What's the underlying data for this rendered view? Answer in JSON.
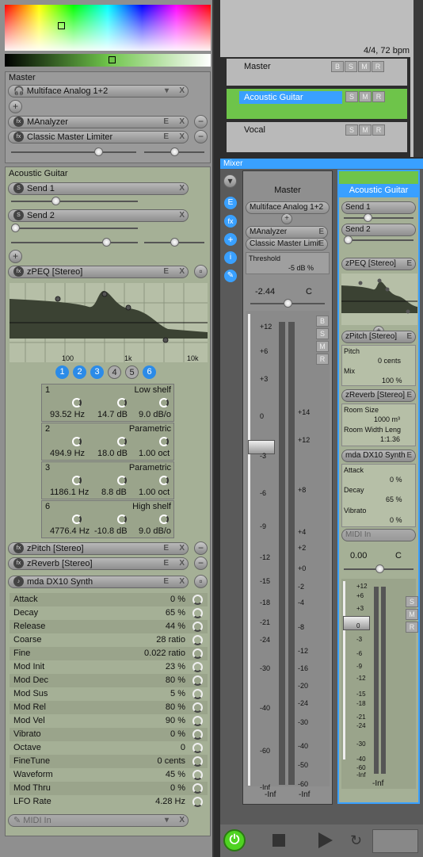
{
  "colors": {
    "panel": "#a5b096",
    "accent": "#39a0ff",
    "green": "#6ec44a"
  },
  "time_sig": "4/4, 72 bpm",
  "inspector": {
    "master_label": "Master",
    "device": "Multiface Analog 1+2",
    "master_fx": [
      "MAnalyzer",
      "Classic Master Limiter"
    ],
    "track_label": "Acoustic Guitar",
    "sends": [
      "Send 1",
      "Send 2"
    ],
    "zpeq": "zPEQ [Stereo]",
    "eq_freq_labels": [
      "100",
      "1k",
      "10k"
    ],
    "band_numbers": [
      "1",
      "2",
      "3",
      "4",
      "5",
      "6"
    ],
    "bands": [
      {
        "num": "1",
        "type": "Low shelf",
        "freq": "93.52 Hz",
        "gain": "14.7 dB",
        "q": "9.0 dB/o"
      },
      {
        "num": "2",
        "type": "Parametric",
        "freq": "494.9 Hz",
        "gain": "18.0 dB",
        "q": "1.00 oct"
      },
      {
        "num": "3",
        "type": "Parametric",
        "freq": "1186.1 Hz",
        "gain": "8.8 dB",
        "q": "1.00 oct"
      },
      {
        "num": "6",
        "type": "High shelf",
        "freq": "4776.4 Hz",
        "gain": "-10.8 dB",
        "q": "9.0 dB/o"
      }
    ],
    "zpitch": "zPitch [Stereo]",
    "zreverb": "zReverb [Stereo]",
    "synth": "mda DX10 Synth",
    "params": [
      {
        "n": "Attack",
        "v": "0 %"
      },
      {
        "n": "Decay",
        "v": "65 %"
      },
      {
        "n": "Release",
        "v": "44 %"
      },
      {
        "n": "Coarse",
        "v": "28 ratio"
      },
      {
        "n": "Fine",
        "v": "0.022 ratio"
      },
      {
        "n": "Mod Init",
        "v": "23 %"
      },
      {
        "n": "Mod Dec",
        "v": "80 %"
      },
      {
        "n": "Mod Sus",
        "v": "5 %"
      },
      {
        "n": "Mod Rel",
        "v": "80 %"
      },
      {
        "n": "Mod Vel",
        "v": "90 %"
      },
      {
        "n": "Vibrato",
        "v": "0 %"
      },
      {
        "n": "Octave",
        "v": "0"
      },
      {
        "n": "FineTune",
        "v": "0 cents"
      },
      {
        "n": "Waveform",
        "v": "45 %"
      },
      {
        "n": "Mod Thru",
        "v": "0 %"
      },
      {
        "n": "LFO Rate",
        "v": "4.28 Hz"
      }
    ],
    "midi_in": "MIDI In"
  },
  "tracks": [
    {
      "name": "Master",
      "btns": [
        "B",
        "S",
        "M",
        "R"
      ]
    },
    {
      "name": "Acoustic Guitar",
      "btns": [
        "S",
        "M",
        "R"
      ]
    },
    {
      "name": "Vocal",
      "btns": [
        "S",
        "M",
        "R"
      ]
    }
  ],
  "mixer": {
    "title": "Mixer",
    "side_buttons": [
      "E",
      "fx",
      "+",
      "i"
    ],
    "master": {
      "name": "Master",
      "device": "Multiface Analog 1+2",
      "fx": [
        "MAnalyzer",
        "Classic Master Limit"
      ],
      "threshold_label": "Threshold",
      "threshold_value": "-5 dB %",
      "volume": "-2.44",
      "pan": "C",
      "peaks": [
        "-Inf",
        "-Inf"
      ],
      "btns": [
        "B",
        "S",
        "M",
        "R"
      ],
      "fader_scale": [
        "+12",
        "+6",
        "+3",
        "0",
        "-3",
        "-6",
        "-9",
        "-12",
        "-15",
        "-18",
        "-21",
        "-24",
        "-30",
        "-40",
        "-60",
        "-Inf"
      ],
      "meter_scale": [
        "+14",
        "+12",
        "+8",
        "+4",
        "+2",
        "+0",
        "-2",
        "-4",
        "-8",
        "-12",
        "-16",
        "-20",
        "-24",
        "-30",
        "-40",
        "-50",
        "-60"
      ]
    },
    "guitar": {
      "name": "Acoustic Guitar",
      "sends": [
        "Send 1",
        "Send 2"
      ],
      "zpeq": "zPEQ [Stereo]",
      "zpitch": "zPitch [Stereo]",
      "pitch_label": "Pitch",
      "pitch_value": "0 cents",
      "mix_label": "Mix",
      "mix_value": "100 %",
      "zreverb": "zReverb [Stereo]",
      "room_size_label": "Room Size",
      "room_size_value": "1000 m³",
      "room_wl_label": "Room Width Leng",
      "room_wl_value": "1:1.36",
      "synth": "mda DX10 Synth",
      "attack_label": "Attack",
      "attack_value": "0 %",
      "decay_label": "Decay",
      "decay_value": "65 %",
      "vibrato_label": "Vibrato",
      "vibrato_value": "0 %",
      "midi_in": "MIDI In",
      "volume": "0.00",
      "pan": "C",
      "peak": "-Inf",
      "btns": [
        "S",
        "M",
        "R"
      ],
      "scale": [
        "+12",
        "+6",
        "+3",
        "0",
        "-3",
        "-6",
        "-9",
        "-12",
        "-15",
        "-18",
        "-21",
        "-24",
        "-30",
        "-40",
        "-60",
        "-Inf"
      ]
    }
  }
}
